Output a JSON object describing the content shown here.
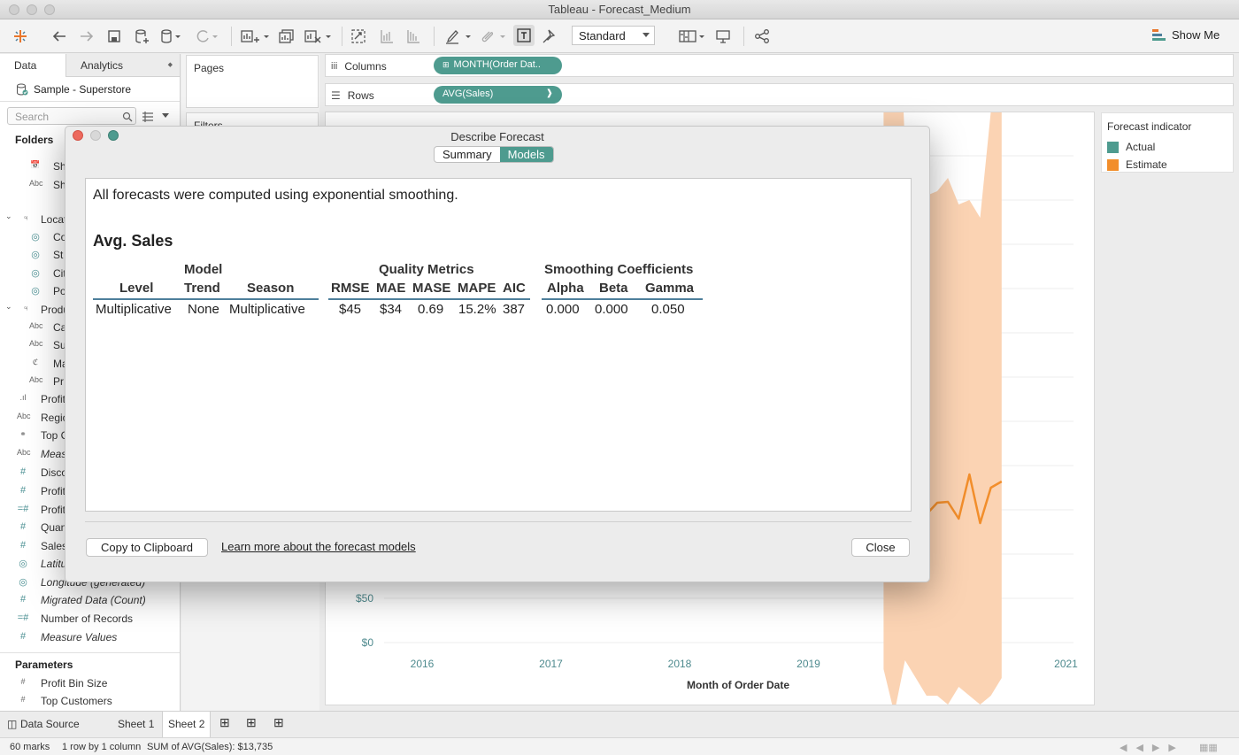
{
  "window": {
    "title": "Tableau - Forecast_Medium"
  },
  "toolbar": {
    "mark_type": "Standard",
    "show_me": "Show Me"
  },
  "left_pane": {
    "tab_data": "Data",
    "tab_analytics": "Analytics",
    "datasource": "Sample - Superstore",
    "search_placeholder": "Search",
    "folders_header": "Folders",
    "fields": [
      {
        "label": "Sh",
        "icon": "calendar-icon"
      },
      {
        "label": "Sh",
        "icon": "abc-icon"
      },
      {
        "label": "Locat",
        "icon": "hierarchy-icon"
      },
      {
        "label": "Co",
        "icon": "globe-icon"
      },
      {
        "label": "St",
        "icon": "globe-icon"
      },
      {
        "label": "Cit",
        "icon": "globe-icon"
      },
      {
        "label": "Po",
        "icon": "globe-icon"
      },
      {
        "label": "Produ",
        "icon": "hierarchy-icon"
      },
      {
        "label": "Ca",
        "icon": "abc-icon"
      },
      {
        "label": "Su",
        "icon": "abc-icon"
      },
      {
        "label": "Ma",
        "icon": "paperclip-icon"
      },
      {
        "label": "Pr",
        "icon": "abc-icon"
      },
      {
        "label": "Profit",
        "icon": "bin-icon"
      },
      {
        "label": "Regio",
        "icon": "abc-icon"
      },
      {
        "label": "Top C",
        "icon": "set-icon"
      },
      {
        "label": "Meas",
        "icon": "abc-icon"
      },
      {
        "label": "Disco",
        "icon": "hash-icon"
      },
      {
        "label": "Profit",
        "icon": "hash-icon"
      },
      {
        "label": "Profit",
        "icon": "hash-icon"
      },
      {
        "label": "Quan",
        "icon": "hash-icon"
      },
      {
        "label": "Sales",
        "icon": "hash-icon"
      },
      {
        "label": "Latitu",
        "icon": "globe-icon"
      },
      {
        "label": "Longitude (generated)",
        "icon": "globe-icon"
      },
      {
        "label": "Migrated Data (Count)",
        "icon": "hash-icon"
      },
      {
        "label": "Number of Records",
        "icon": "hash-icon"
      },
      {
        "label": "Measure Values",
        "icon": "hash-icon"
      }
    ],
    "parameters_header": "Parameters",
    "parameters": [
      "Profit Bin Size",
      "Top Customers"
    ]
  },
  "shelves": {
    "pages": "Pages",
    "filters": "Filters",
    "columns_label": "Columns",
    "columns_pill": "MONTH(Order Dat..",
    "rows_label": "Rows",
    "rows_pill": "AVG(Sales)"
  },
  "legend": {
    "title": "Forecast indicator",
    "items": [
      {
        "label": "Actual",
        "color": "#4e9b8f"
      },
      {
        "label": "Estimate",
        "color": "#f28e2b"
      }
    ]
  },
  "chart_data": {
    "type": "line",
    "xlabel": "Month of Order Date",
    "x_ticks": [
      "2016",
      "2017",
      "2018",
      "2019",
      "2020",
      "2021"
    ],
    "y_ticks": [
      "$50",
      "$0"
    ],
    "series": [
      {
        "name": "Estimate",
        "color": "#f28e2b",
        "x": [
          "2020-01",
          "2020-02",
          "2020-03",
          "2020-04",
          "2020-05",
          "2020-06",
          "2020-07",
          "2020-08",
          "2020-09",
          "2020-10",
          "2020-11",
          "2020-12"
        ],
        "values": [
          185,
          95,
          307,
          156,
          145,
          158,
          159,
          140,
          190,
          135,
          175,
          182
        ],
        "upper": [
          720,
          860,
          560,
          460,
          505,
          510,
          525,
          495,
          500,
          480,
          600,
          610
        ],
        "lower": [
          -30,
          -80,
          -20,
          -40,
          -60,
          -60,
          -70,
          -50,
          -60,
          -70,
          -60,
          -40
        ]
      }
    ]
  },
  "dialog": {
    "title": "Describe Forecast",
    "tab_summary": "Summary",
    "tab_models": "Models",
    "intro": "All forecasts were computed using exponential smoothing.",
    "measure": "Avg. Sales",
    "group_model": "Model",
    "group_quality": "Quality Metrics",
    "group_smoothing": "Smoothing Coefficients",
    "columns": [
      "Level",
      "Trend",
      "Season",
      "RMSE",
      "MAE",
      "MASE",
      "MAPE",
      "AIC",
      "Alpha",
      "Beta",
      "Gamma"
    ],
    "row": [
      "Multiplicative",
      "None",
      "Multiplicative",
      "$45",
      "$34",
      "0.69",
      "15.2%",
      "387",
      "0.000",
      "0.000",
      "0.050"
    ],
    "copy_button": "Copy to Clipboard",
    "learn_link": "Learn more about the forecast models",
    "close_button": "Close"
  },
  "sheet_tabs": {
    "data_source": "Data Source",
    "sheet1": "Sheet 1",
    "sheet2": "Sheet 2"
  },
  "status": {
    "marks": "60 marks",
    "dims": "1 row by 1 column",
    "sum": "SUM of AVG(Sales): $13,735"
  }
}
